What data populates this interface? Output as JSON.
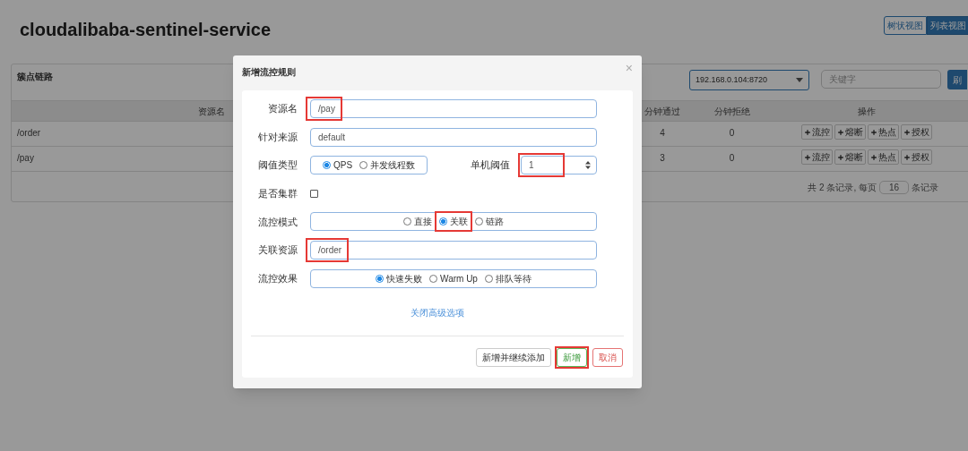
{
  "page": {
    "title": "cloudalibaba-sentinel-service",
    "view_toggle": [
      {
        "label": "树状视图",
        "selected": false
      },
      {
        "label": "列表视图",
        "selected": true
      }
    ]
  },
  "panel": {
    "title": "簇点链路",
    "machine_select": {
      "value": "192.168.0.104:8720"
    },
    "search": {
      "placeholder": "关键字"
    },
    "refresh_button": "刷",
    "table": {
      "columns": [
        "资源名",
        "分钟通过",
        "分钟拒绝",
        "操作"
      ],
      "rows": [
        {
          "resource": "/order",
          "passed": "4",
          "rejected": "0",
          "actions": [
            "流控",
            "熔断",
            "热点",
            "授权"
          ]
        },
        {
          "resource": "/pay",
          "passed": "3",
          "rejected": "0",
          "actions": [
            "流控",
            "熔断",
            "热点",
            "授权"
          ]
        }
      ]
    },
    "pagination": {
      "summary": "共 2 条记录, 每页",
      "page_size": "16",
      "suffix": "条记录"
    }
  },
  "dialog": {
    "title": "新增流控规则",
    "close": "×",
    "fields": [
      {
        "kind": "text",
        "label": "资源名",
        "value": "/pay",
        "highlighted": true
      },
      {
        "kind": "text",
        "label": "针对来源",
        "value": "default",
        "highlighted": false
      },
      {
        "kind": "threshold",
        "label": "阈值类型",
        "options": [
          {
            "label": "QPS",
            "selected": true,
            "highlighted": false
          },
          {
            "label": "并发线程数",
            "selected": false,
            "highlighted": false
          }
        ],
        "number_label": "单机阈值",
        "number_value": "1",
        "number_highlighted": true
      },
      {
        "kind": "checkbox",
        "label": "是否集群",
        "checked": false
      },
      {
        "kind": "radio",
        "label": "流控模式",
        "options": [
          {
            "label": "直接",
            "selected": false,
            "highlighted": false
          },
          {
            "label": "关联",
            "selected": true,
            "highlighted": true
          },
          {
            "label": "链路",
            "selected": false,
            "highlighted": false
          }
        ]
      },
      {
        "kind": "text",
        "label": "关联资源",
        "value": "/order",
        "highlighted": true
      },
      {
        "kind": "radio",
        "label": "流控效果",
        "options": [
          {
            "label": "快速失败",
            "selected": true,
            "highlighted": false
          },
          {
            "label": "Warm Up",
            "selected": false,
            "highlighted": false
          },
          {
            "label": "排队等待",
            "selected": false,
            "highlighted": false
          }
        ]
      }
    ],
    "link": "关闭高级选项",
    "buttons": [
      {
        "label": "新增并继续添加",
        "kind": "default",
        "highlighted": false
      },
      {
        "label": "新增",
        "kind": "success",
        "highlighted": true
      },
      {
        "label": "取消",
        "kind": "danger",
        "highlighted": false
      }
    ]
  }
}
